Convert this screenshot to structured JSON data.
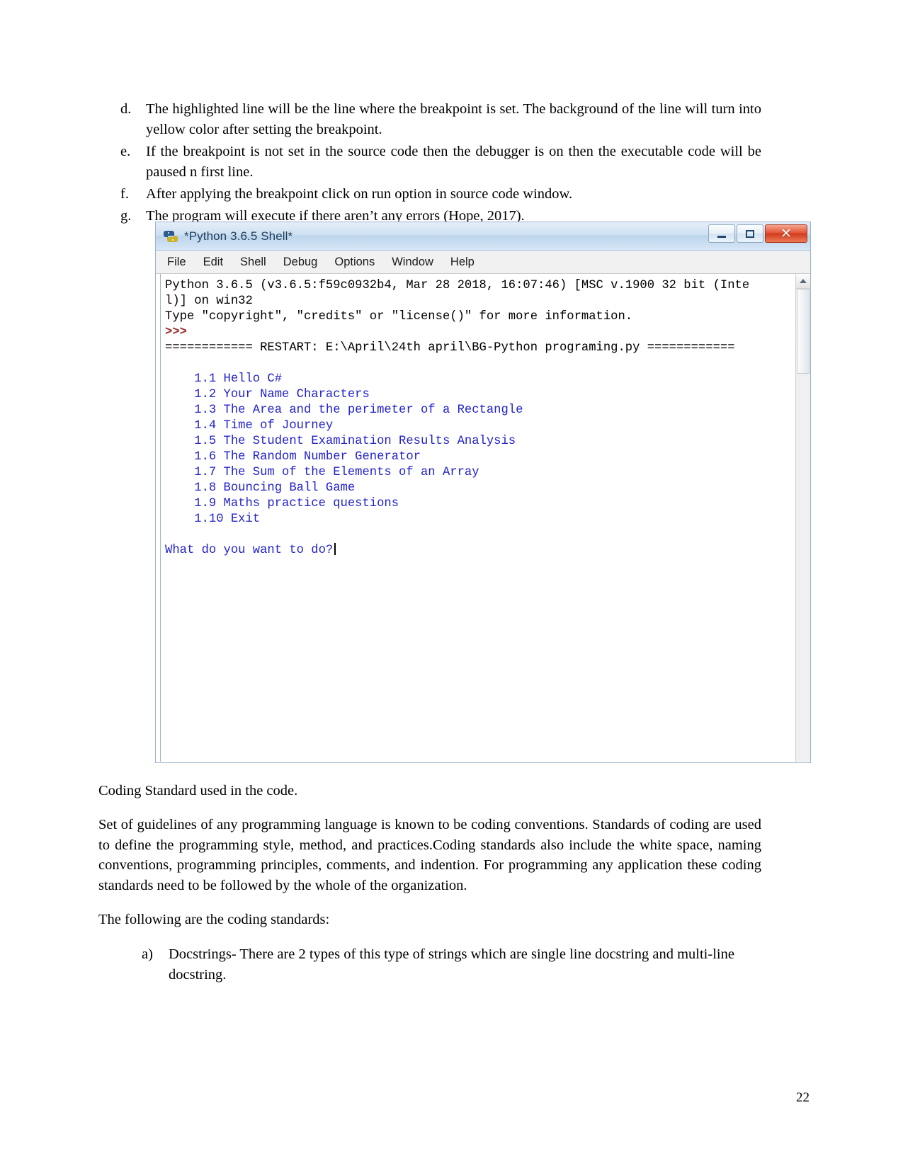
{
  "top_list": [
    {
      "marker": "d.",
      "text": "The highlighted line will be the line where the breakpoint is set. The background of the line will turn into yellow color after setting the breakpoint."
    },
    {
      "marker": "e.",
      "text": "If the breakpoint is not set in the source code then the debugger is on then the executable code will be paused n first line."
    },
    {
      "marker": "f.",
      "text": "After applying the breakpoint click on run option in source code window."
    },
    {
      "marker": "g.",
      "text": "The program will execute if there aren’t any errors (Hope, 2017)."
    }
  ],
  "idle_window": {
    "title": "*Python 3.6.5 Shell*",
    "icon": "python-idle-icon",
    "window_buttons": {
      "minimize": "minimize-icon",
      "maximize": "maximize-icon",
      "close": "✕"
    },
    "menu": [
      "File",
      "Edit",
      "Shell",
      "Debug",
      "Options",
      "Window",
      "Help"
    ],
    "console": {
      "banner_line1": "Python 3.6.5 (v3.6.5:f59c0932b4, Mar 28 2018, 16:07:46) [MSC v.1900 32 bit (Inte",
      "banner_line2": "l)] on win32",
      "banner_line3": "Type \"copyright\", \"credits\" or \"license()\" for more information.",
      "prompt": ">>>",
      "restart": "============ RESTART: E:\\April\\24th april\\BG-Python programing.py ============",
      "menu_items": [
        "    1.1 Hello C#",
        "    1.2 Your Name Characters",
        "    1.3 The Area and the perimeter of a Rectangle",
        "    1.4 Time of Journey",
        "    1.5 The Student Examination Results Analysis",
        "    1.6 The Random Number Generator",
        "    1.7 The Sum of the Elements of an Array",
        "    1.8 Bouncing Ball Game",
        "    1.9 Maths practice questions",
        "    1.10 Exit"
      ],
      "question": "What do you want to do?"
    }
  },
  "body": {
    "heading": "Coding Standard used in the code.",
    "paragraph1": "Set of guidelines of any programming language is known to be coding conventions. Standards of coding are used to define the programming style, method, and practices.Coding standards also include the white space, naming conventions, programming principles, comments, and indention. For programming any application these coding standards need to be followed by the whole of the organization.",
    "paragraph2": "The following are the coding standards:",
    "sub_list": [
      {
        "marker": "a)",
        "text": "Docstrings- There are 2 types of this type of strings which are single line docstring and multi-line docstring."
      }
    ]
  },
  "page_number": "22",
  "colors": {
    "console_blue": "#2222cc",
    "console_prompt_red": "#9e2b2b",
    "title_bar_blue": "#bcd5ec",
    "close_button_red": "#d13c1c"
  }
}
